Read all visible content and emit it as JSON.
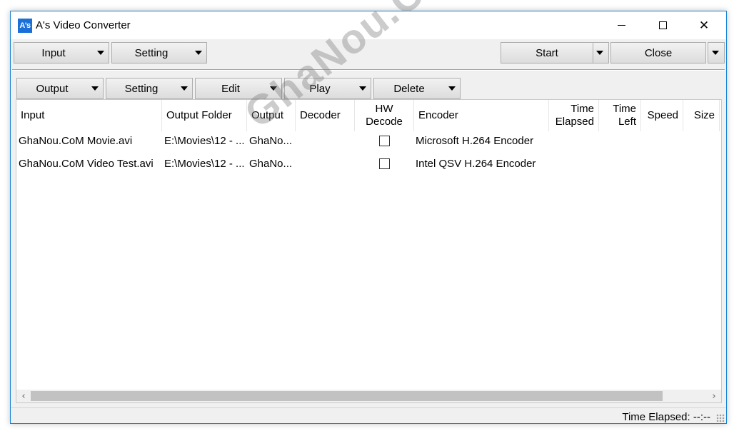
{
  "window": {
    "title": "A's Video Converter",
    "logo": "A's",
    "accent": "#1883d7",
    "logo_color": "#1b6fd8"
  },
  "titlebar_buttons": {
    "minimize": "minimize-icon",
    "maximize": "maximize-icon",
    "close": "close-icon",
    "close_glyph": "✕"
  },
  "toolbar1": {
    "input_label": "Input",
    "setting_label": "Setting",
    "start_label": "Start",
    "close_label": "Close"
  },
  "toolbar2": {
    "output_label": "Output",
    "setting_label": "Setting",
    "edit_label": "Edit",
    "play_label": "Play",
    "delete_label": "Delete"
  },
  "table": {
    "headers": {
      "input": "Input",
      "output_folder": "Output Folder",
      "output": "Output",
      "decoder": "Decoder",
      "hw1": "HW",
      "hw2": "Decode",
      "encoder": "Encoder",
      "elapsed1": "Time",
      "elapsed2": "Elapsed",
      "left1": "Time",
      "left2": "Left",
      "speed": "Speed",
      "size": "Size"
    },
    "rows": [
      {
        "input": "GhaNou.CoM Movie.avi",
        "output_folder": "E:\\Movies\\12 - ...",
        "output": "GhaNo...",
        "hw_decode": false,
        "encoder": "Microsoft H.264 Encoder"
      },
      {
        "input": "GhaNou.CoM Video Test.avi",
        "output_folder": "E:\\Movies\\12 - ...",
        "output": "GhaNo...",
        "hw_decode": false,
        "encoder": "Intel QSV H.264 Encoder"
      }
    ]
  },
  "scrollbar": {
    "left_glyph": "‹",
    "right_glyph": "›"
  },
  "status": {
    "text": "Time Elapsed: --:--"
  },
  "watermark": "GhaNou.CoM"
}
